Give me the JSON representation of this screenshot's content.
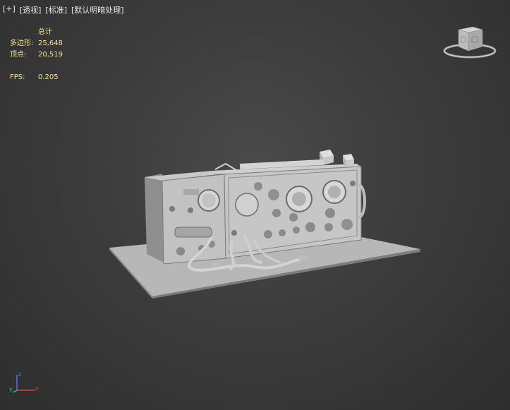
{
  "viewport": {
    "labels": {
      "plus": "[+]",
      "view": "[透视]",
      "shading": "[标准]",
      "lighting": "[默认明暗处理]"
    },
    "stats": {
      "header": "总计",
      "polygons_label": "多边形:",
      "polygons_value": "25,648",
      "vertices_label": "顶点:",
      "vertices_value": "20,519",
      "fps_label": "FPS:",
      "fps_value": "0.205"
    },
    "axis": {
      "x": "x",
      "y": "y",
      "z": "z"
    },
    "colors": {
      "stats_text": "#f3e38a",
      "label_text": "#e6e6e6",
      "axis_x": "#e23b3b",
      "axis_y": "#41c24b",
      "axis_z": "#4a73e8"
    },
    "icons": [
      "viewcube-icon",
      "axis-tripod-icon"
    ]
  }
}
